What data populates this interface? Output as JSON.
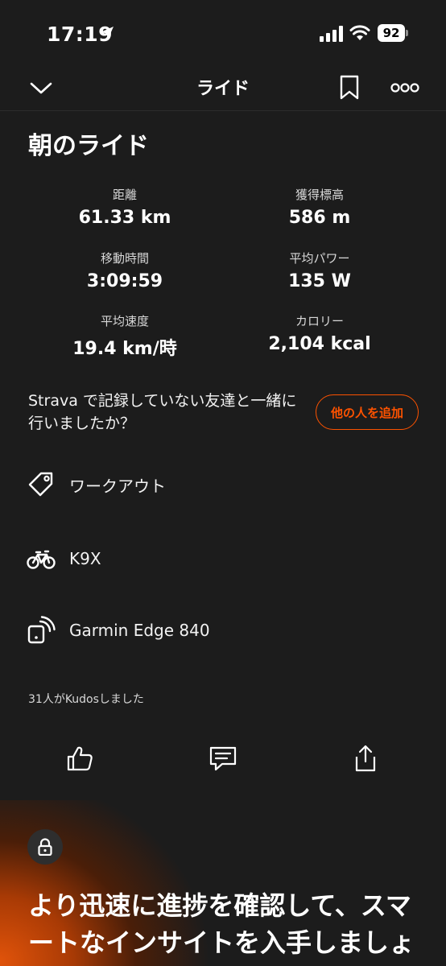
{
  "status_bar": {
    "time": "17:19",
    "battery": "92"
  },
  "header": {
    "title": "ライド"
  },
  "activity": {
    "title": "朝のライド",
    "stats": [
      {
        "label": "距離",
        "value": "61.33 km"
      },
      {
        "label": "獲得標高",
        "value": "586 m"
      },
      {
        "label": "移動時間",
        "value": "3:09:59"
      },
      {
        "label": "平均パワー",
        "value": "135 W"
      },
      {
        "label": "平均速度",
        "value": "19.4 km/時"
      },
      {
        "label": "カロリー",
        "value": "2,104 kcal"
      }
    ]
  },
  "prompt": {
    "text": "Strava で記録していない友達と一緒に行いましたか？",
    "button_label": "他の人を追加"
  },
  "details": {
    "workout_type": "ワークアウト",
    "bike": "K9X",
    "device": "Garmin Edge 840"
  },
  "kudos": {
    "text": "31人がKudosしました"
  },
  "promo": {
    "text": "より迅速に進捗を確認して、スマートなインサイトを入手しましょう"
  },
  "colors": {
    "background": "#1c1c1c",
    "accent": "#fc5200",
    "text": "#ffffff"
  },
  "icons": {
    "back": "chevron-down-icon",
    "bookmark": "bookmark-icon",
    "more": "more-icon",
    "workout": "tag-icon",
    "bike": "bike-icon",
    "device": "device-sync-icon",
    "kudos": "thumbs-up-icon",
    "comment": "comment-icon",
    "share": "share-icon",
    "lock": "lock-icon"
  }
}
